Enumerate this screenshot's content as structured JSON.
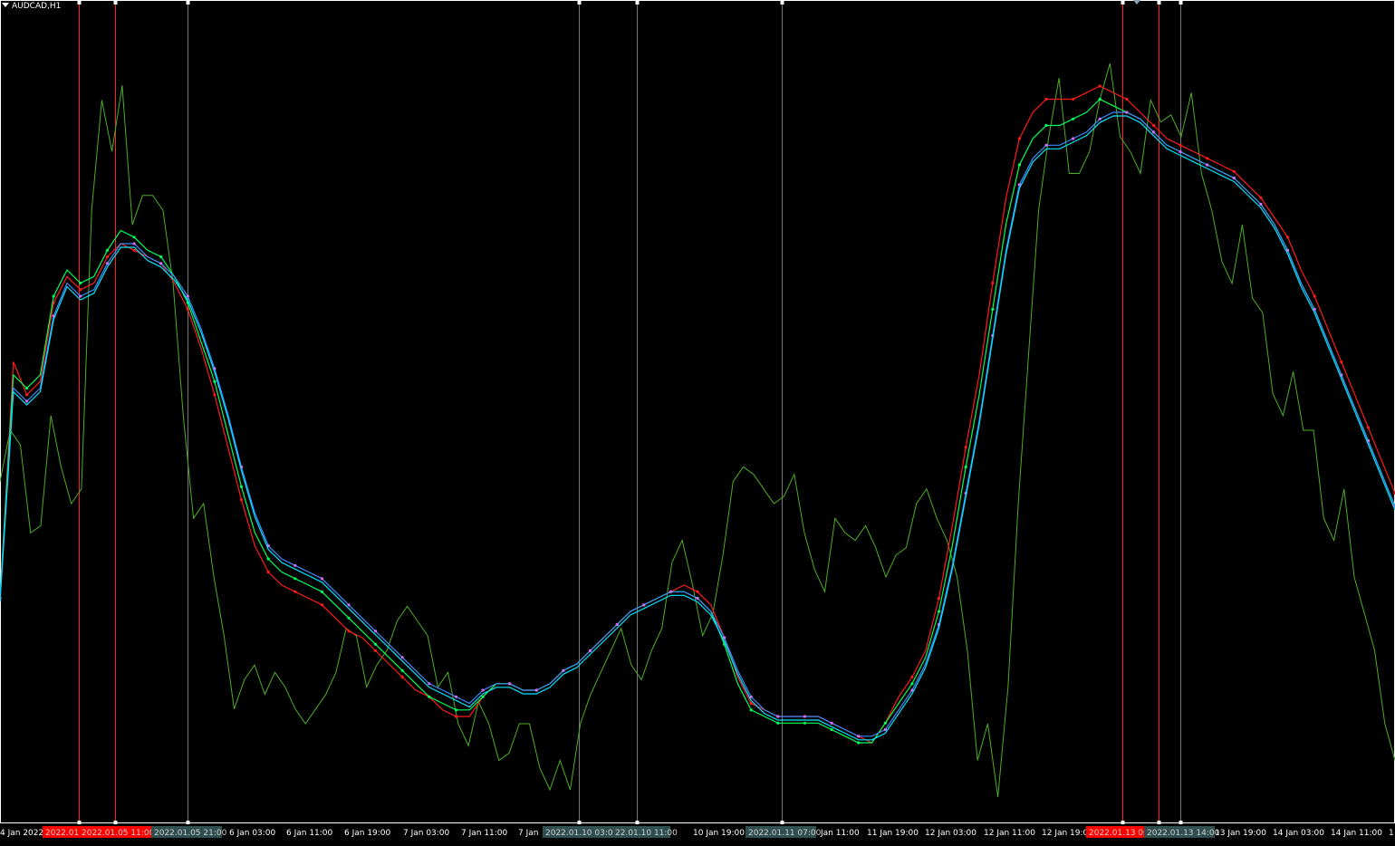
{
  "window": {
    "symbol": "AUDCAD,H1"
  },
  "colors": {
    "background": "#000000",
    "price": "#4caf22",
    "ma_red": "#ff1a1a",
    "ma_green": "#00ff55",
    "ma_blue": "#3b8bff",
    "ma_cyan": "#00e5ff",
    "ma_magenta": "#d46bff",
    "vline_red": "#ff2020",
    "vline_gray": "#777777",
    "axis_text": "#ffffff",
    "tag_red": "#ff0000",
    "tag_gray": "#2f4f4f"
  },
  "chart_data": {
    "type": "line",
    "xlabels": [
      "4 Jan 2022",
      "6 Jan 03:00",
      "6 Jan 11:00",
      "6 Jan 19:00",
      "7 Jan 03:00",
      "7 Jan 11:00",
      "7 Jan",
      "10 Jan 19:00",
      "Jan 11:00",
      "11 Jan 19:00",
      "12 Jan 03:00",
      "12 Jan 11:00",
      "12 Jan 19:0",
      "13 Jan 19:00",
      "14 Jan 03:00",
      "14 Jan 11:00",
      "1"
    ],
    "vertical_markers": [
      {
        "label": "2022.01.",
        "color": "red"
      },
      {
        "label": "2022.01.05 11:00",
        "color": "red"
      },
      {
        "label": "2022.01.05 21:00",
        "color": "gray"
      },
      {
        "label": "2022.01.10 03:00",
        "color": "gray"
      },
      {
        "label": "22.01.10 11:00",
        "color": "gray"
      },
      {
        "label": "2022.01.11 07:00",
        "color": "gray"
      },
      {
        "label": "2022.01.13 06",
        "color": "red"
      },
      {
        "label": "2022.01.13 14:00",
        "color": "gray"
      }
    ],
    "series": [
      {
        "values": [
          0.43,
          0.5,
          0.48,
          0.36,
          0.37,
          0.52,
          0.45,
          0.4,
          0.42,
          0.8,
          0.95,
          0.88,
          0.97,
          0.78,
          0.82,
          0.82,
          0.8,
          0.7,
          0.52,
          0.38,
          0.4,
          0.3,
          0.22,
          0.12,
          0.16,
          0.18,
          0.14,
          0.17,
          0.15,
          0.12,
          0.1,
          0.12,
          0.14,
          0.17,
          0.23,
          0.22,
          0.15,
          0.18,
          0.2,
          0.24,
          0.26,
          0.24,
          0.22,
          0.15,
          0.17,
          0.1,
          0.07,
          0.13,
          0.1,
          0.05,
          0.06,
          0.1,
          0.1,
          0.04,
          0.01,
          0.05,
          0.01,
          0.1,
          0.14,
          0.17,
          0.2,
          0.23,
          0.18,
          0.16,
          0.2,
          0.23,
          0.32,
          0.35,
          0.29,
          0.22,
          0.25,
          0.33,
          0.43,
          0.45,
          0.44,
          0.42,
          0.4,
          0.41,
          0.44,
          0.36,
          0.31,
          0.28,
          0.38,
          0.36,
          0.35,
          0.37,
          0.34,
          0.3,
          0.33,
          0.34,
          0.4,
          0.42,
          0.38,
          0.35,
          0.3,
          0.2,
          0.05,
          0.1,
          0.0,
          0.15,
          0.4,
          0.6,
          0.8,
          0.9,
          0.98,
          0.85,
          0.85,
          0.88,
          0.95,
          1.0,
          0.9,
          0.88,
          0.85,
          0.95,
          0.92,
          0.93,
          0.9,
          0.96,
          0.85,
          0.8,
          0.73,
          0.7,
          0.78,
          0.68,
          0.66,
          0.55,
          0.52,
          0.58,
          0.5,
          0.5,
          0.38,
          0.35,
          0.42,
          0.3,
          0.25,
          0.2,
          0.1,
          0.05
        ]
      },
      {
        "values": [
          0.22,
          0.58,
          0.53,
          0.55,
          0.67,
          0.71,
          0.69,
          0.7,
          0.74,
          0.76,
          0.75,
          0.74,
          0.73,
          0.7,
          0.66,
          0.6,
          0.53,
          0.45,
          0.37,
          0.3,
          0.26,
          0.24,
          0.23,
          0.22,
          0.21,
          0.19,
          0.17,
          0.16,
          0.14,
          0.12,
          0.1,
          0.08,
          0.07,
          0.05,
          0.04,
          0.04,
          0.07,
          0.09,
          0.09,
          0.08,
          0.08,
          0.09,
          0.11,
          0.12,
          0.14,
          0.16,
          0.18,
          0.2,
          0.21,
          0.22,
          0.23,
          0.24,
          0.23,
          0.21,
          0.16,
          0.1,
          0.06,
          0.05,
          0.04,
          0.04,
          0.04,
          0.04,
          0.03,
          0.02,
          0.01,
          0.0,
          0.03,
          0.07,
          0.1,
          0.14,
          0.22,
          0.33,
          0.45,
          0.56,
          0.7,
          0.83,
          0.92,
          0.96,
          0.98,
          0.98,
          0.98,
          0.99,
          1.0,
          0.99,
          0.98,
          0.96,
          0.94,
          0.92,
          0.91,
          0.9,
          0.89,
          0.88,
          0.87,
          0.85,
          0.83,
          0.8,
          0.77,
          0.72,
          0.68,
          0.63,
          0.58,
          0.53,
          0.48,
          0.43,
          0.38
        ]
      },
      {
        "values": [
          0.22,
          0.56,
          0.54,
          0.56,
          0.68,
          0.72,
          0.7,
          0.71,
          0.75,
          0.78,
          0.77,
          0.75,
          0.74,
          0.71,
          0.67,
          0.61,
          0.55,
          0.47,
          0.39,
          0.32,
          0.28,
          0.26,
          0.25,
          0.24,
          0.23,
          0.21,
          0.19,
          0.17,
          0.15,
          0.13,
          0.11,
          0.09,
          0.07,
          0.06,
          0.05,
          0.05,
          0.07,
          0.09,
          0.09,
          0.08,
          0.08,
          0.09,
          0.11,
          0.12,
          0.14,
          0.16,
          0.18,
          0.2,
          0.21,
          0.22,
          0.23,
          0.23,
          0.22,
          0.2,
          0.15,
          0.09,
          0.05,
          0.04,
          0.03,
          0.03,
          0.03,
          0.03,
          0.02,
          0.01,
          0.0,
          0.0,
          0.03,
          0.06,
          0.09,
          0.13,
          0.2,
          0.3,
          0.42,
          0.53,
          0.66,
          0.79,
          0.88,
          0.92,
          0.94,
          0.94,
          0.95,
          0.96,
          0.98,
          0.97,
          0.96,
          0.95,
          0.93,
          0.91,
          0.9,
          0.89,
          0.88,
          0.87,
          0.86,
          0.84,
          0.82,
          0.79,
          0.75,
          0.7,
          0.66,
          0.61,
          0.56,
          0.51,
          0.46,
          0.41,
          0.36
        ]
      },
      {
        "values": [
          0.22,
          0.54,
          0.52,
          0.54,
          0.65,
          0.7,
          0.68,
          0.69,
          0.73,
          0.76,
          0.76,
          0.74,
          0.73,
          0.71,
          0.68,
          0.63,
          0.57,
          0.5,
          0.42,
          0.35,
          0.3,
          0.28,
          0.27,
          0.26,
          0.25,
          0.23,
          0.21,
          0.19,
          0.17,
          0.15,
          0.13,
          0.11,
          0.09,
          0.08,
          0.07,
          0.06,
          0.08,
          0.09,
          0.09,
          0.08,
          0.08,
          0.09,
          0.11,
          0.12,
          0.14,
          0.16,
          0.18,
          0.2,
          0.21,
          0.22,
          0.23,
          0.23,
          0.22,
          0.2,
          0.16,
          0.11,
          0.07,
          0.05,
          0.04,
          0.04,
          0.04,
          0.04,
          0.03,
          0.02,
          0.01,
          0.01,
          0.02,
          0.05,
          0.08,
          0.12,
          0.18,
          0.27,
          0.38,
          0.49,
          0.62,
          0.75,
          0.85,
          0.89,
          0.91,
          0.91,
          0.92,
          0.93,
          0.95,
          0.96,
          0.96,
          0.95,
          0.93,
          0.91,
          0.9,
          0.89,
          0.88,
          0.87,
          0.86,
          0.84,
          0.82,
          0.79,
          0.75,
          0.7,
          0.66,
          0.61,
          0.56,
          0.51,
          0.46,
          0.41,
          0.36
        ]
      }
    ]
  }
}
